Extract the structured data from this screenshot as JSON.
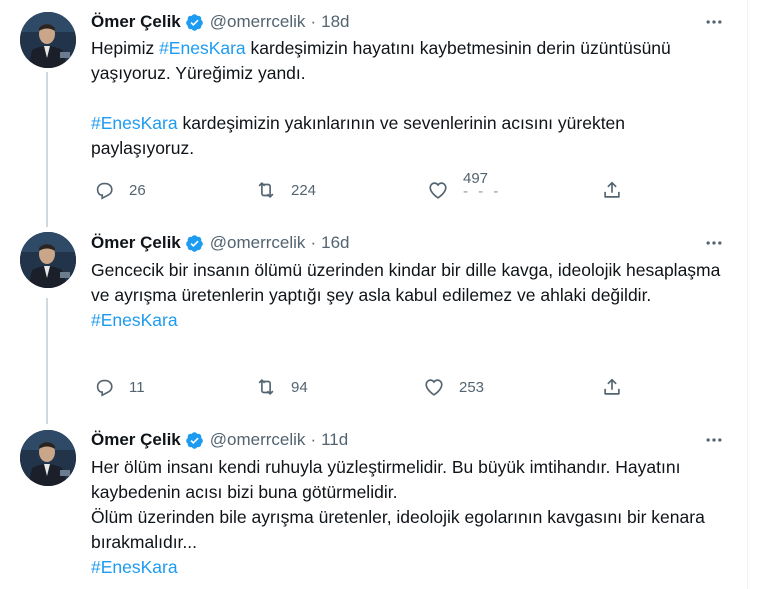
{
  "tweets": [
    {
      "name": "Ömer Çelik",
      "handle": "@omerrcelik",
      "separator": "·",
      "time": "18d",
      "paragraphs": [
        [
          {
            "t": "Hepimiz ",
            "tag": false
          },
          {
            "t": "#EnesKara",
            "tag": true
          },
          {
            "t": " kardeşimizin hayatını kaybetmesinin derin üzüntüsünü yaşıyoruz. Yüreğimiz yandı.",
            "tag": false
          }
        ],
        [],
        [
          {
            "t": "#EnesKara",
            "tag": true
          },
          {
            "t": " kardeşimizin yakınlarının ve sevenlerinin acısını yürekten paylaşıyoruz.",
            "tag": false
          }
        ]
      ],
      "replies": "26",
      "retweets": "224",
      "likes": "497",
      "likes_ghost": "- - -"
    },
    {
      "name": "Ömer Çelik",
      "handle": "@omerrcelik",
      "separator": "·",
      "time": "16d",
      "paragraphs": [
        [
          {
            "t": "Gencecik bir insanın ölümü üzerinden kindar bir dille kavga, ideolojik hesaplaşma ve ayrışma üretenlerin yaptığı şey asla kabul edilemez ve ahlaki değildir.",
            "tag": false
          }
        ],
        [
          {
            "t": "#EnesKara",
            "tag": true
          }
        ]
      ],
      "replies": "11",
      "retweets": "94",
      "likes": "253"
    },
    {
      "name": "Ömer Çelik",
      "handle": "@omerrcelik",
      "separator": "·",
      "time": "11d",
      "paragraphs": [
        [
          {
            "t": "Her ölüm insanı kendi ruhuyla yüzleştirmelidir. Bu büyük imtihandır. Hayatını kaybedenin acısı bizi buna götürmelidir.",
            "tag": false
          }
        ],
        [
          {
            "t": "Ölüm üzerinden bile ayrışma üretenler, ideolojik egolarının kavgasını bir kenara bırakmalıdır...",
            "tag": false
          }
        ],
        [
          {
            "t": "#EnesKara",
            "tag": true
          }
        ]
      ]
    }
  ],
  "icons": {
    "verified": "verified-badge-icon",
    "more": "more-options-icon",
    "reply": "reply-icon",
    "retweet": "retweet-icon",
    "like": "like-icon",
    "share": "share-icon"
  },
  "colors": {
    "link": "#1d9bf0",
    "text": "#0f1419",
    "secondary": "#536471",
    "thread_line": "#cfd9de"
  }
}
